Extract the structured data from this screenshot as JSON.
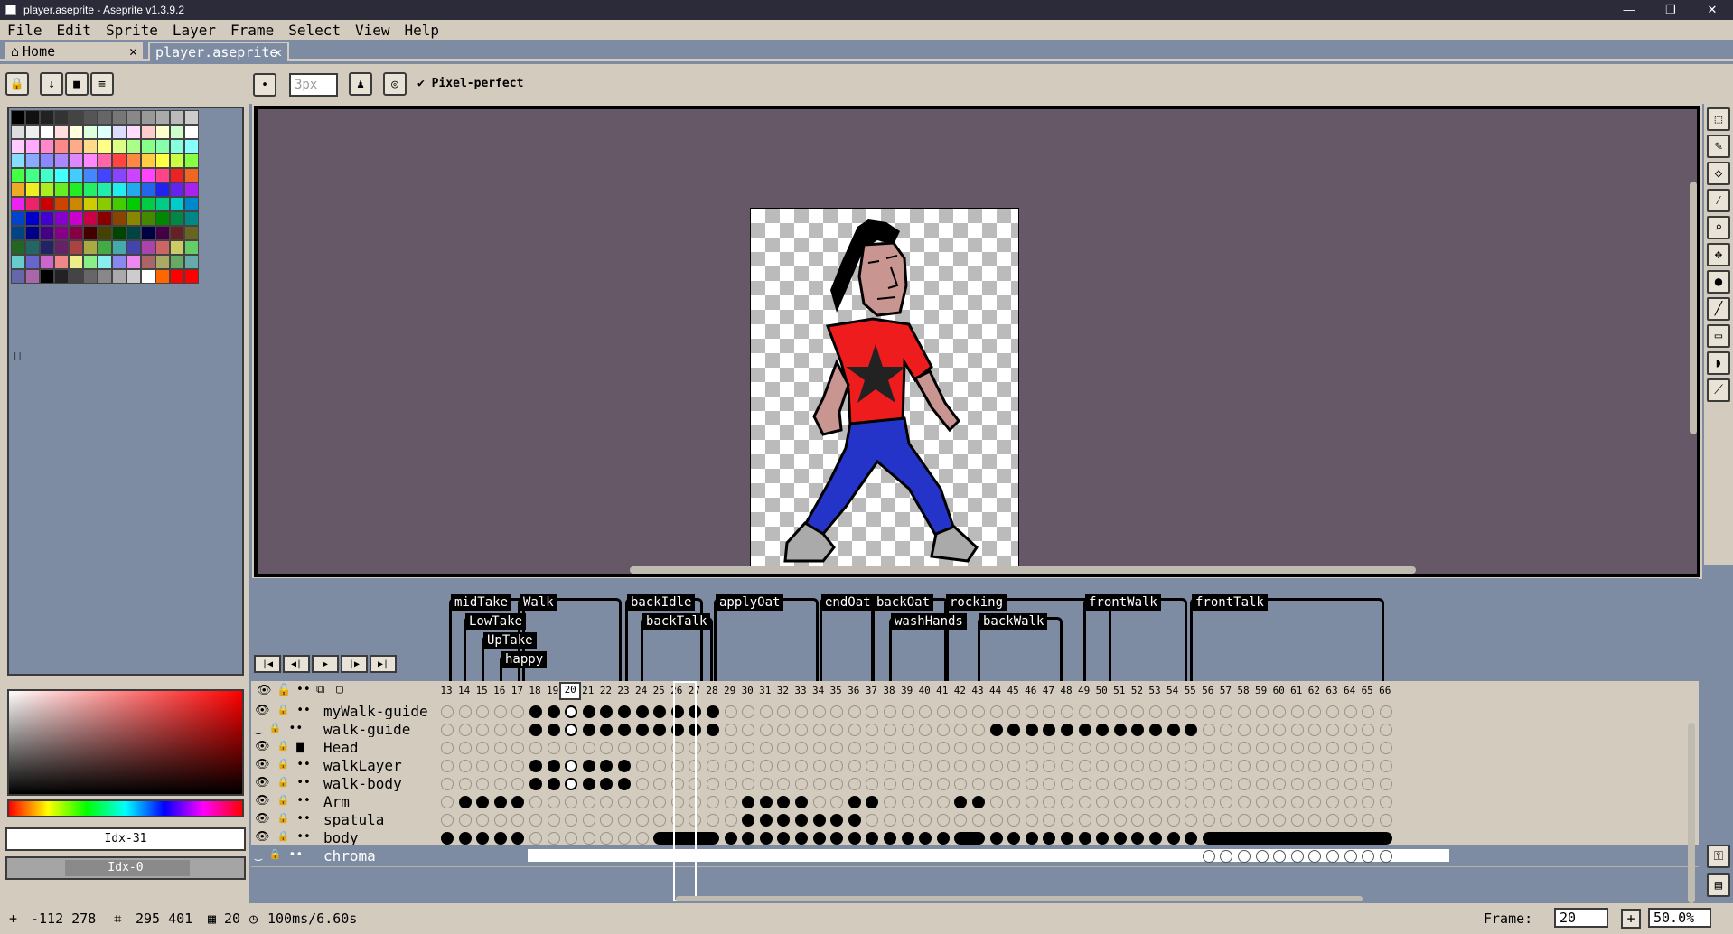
{
  "window": {
    "title": "player.aseprite - Aseprite v1.3.9.2"
  },
  "menu": [
    "File",
    "Edit",
    "Sprite",
    "Layer",
    "Frame",
    "Select",
    "View",
    "Help"
  ],
  "tabs": [
    {
      "label": "Home",
      "icon": "home-icon"
    },
    {
      "label": "player.aseprite"
    }
  ],
  "toolbar": {
    "brush_size": "3px",
    "pixel_perfect": "Pixel-perfect"
  },
  "color_bar": {
    "fg_index": "Idx-31",
    "bg_index": "Idx-0"
  },
  "tags_row1": [
    {
      "label": "midTake"
    },
    {
      "label": "Walk"
    },
    {
      "label": "backIdle"
    },
    {
      "label": "applyOat"
    },
    {
      "label": "endOat"
    },
    {
      "label": "backOat"
    },
    {
      "label": "rocking"
    },
    {
      "label": "frontWalk"
    },
    {
      "label": "frontTalk"
    }
  ],
  "tags_row2": [
    {
      "label": "LowTake"
    },
    {
      "label": "backTalk"
    },
    {
      "label": "washHands"
    },
    {
      "label": "backWalk"
    }
  ],
  "tags_row3": [
    {
      "label": "UpTake"
    }
  ],
  "tags_row4": [
    {
      "label": "happy"
    }
  ],
  "frames": {
    "first": 13,
    "last": 66,
    "current": 20
  },
  "layers": [
    {
      "name": "myWalk-guide",
      "visible": true
    },
    {
      "name": "walk-guide",
      "visible": false
    },
    {
      "name": "Head",
      "visible": true,
      "group": true
    },
    {
      "name": "walkLayer",
      "visible": true
    },
    {
      "name": "walk-body",
      "visible": true
    },
    {
      "name": "Arm",
      "visible": true
    },
    {
      "name": "spatula",
      "visible": true
    },
    {
      "name": "body",
      "visible": true
    },
    {
      "name": "chroma",
      "visible": false
    }
  ],
  "status": {
    "pos": "-112 278",
    "size": "295 401",
    "frame": "20",
    "duration": "100ms/6.60s",
    "frame_label": "Frame:",
    "frame_value": "20",
    "zoom": "50.0%"
  }
}
